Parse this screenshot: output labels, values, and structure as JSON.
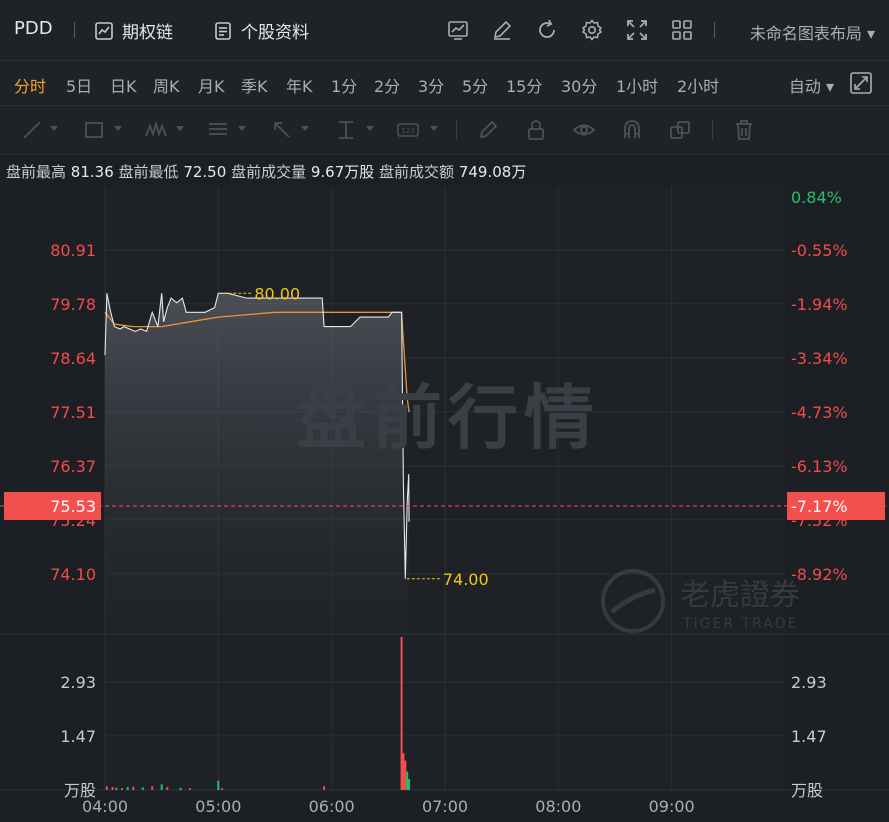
{
  "header": {
    "symbol": "PDD",
    "options_chain": "期权链",
    "profile": "个股资料",
    "layout_name": "未命名图表布局"
  },
  "timeframes": [
    "分时",
    "5日",
    "日K",
    "周K",
    "月K",
    "季K",
    "年K",
    "1分",
    "2分",
    "3分",
    "5分",
    "15分",
    "30分",
    "1小时",
    "2小时"
  ],
  "active_timeframe": "分时",
  "scale_mode": "自动",
  "premarket_stats": {
    "high_label": "盘前最高",
    "high": "81.36",
    "low_label": "盘前最低",
    "low": "72.50",
    "volume_label": "盘前成交量",
    "volume": "9.67万股",
    "turnover_label": "盘前成交额",
    "turnover": "749.08万"
  },
  "watermark": "盘前行情",
  "brand": {
    "cn": "老虎證券",
    "en": "TIGER TRADE"
  },
  "colors": {
    "up": "#20c36b",
    "down": "#f44d4d",
    "accent": "#f5a623",
    "current": "#f2504f"
  },
  "chart_data": {
    "type": "line",
    "x_ticks": [
      "04:00",
      "05:00",
      "06:00",
      "07:00",
      "08:00",
      "09:00"
    ],
    "price_ticks": [
      "80.91",
      "79.78",
      "78.64",
      "77.51",
      "76.37",
      "75.24",
      "74.10"
    ],
    "pct_ticks": [
      "0.84%",
      "-0.55%",
      "-1.94%",
      "-3.34%",
      "-4.73%",
      "-6.13%",
      "-7.52%",
      "-8.92%"
    ],
    "price_range": [
      73.0,
      82.0
    ],
    "current_price": "75.53",
    "current_pct": "-7.17%",
    "high_marker": "80.00",
    "low_marker": "74.00",
    "volume_ticks": [
      "2.93",
      "1.47"
    ],
    "volume_unit": "万股",
    "price_series": [
      {
        "t": "04:00",
        "v": 78.7
      },
      {
        "t": "04:01",
        "v": 80.0
      },
      {
        "t": "04:03",
        "v": 79.6
      },
      {
        "t": "04:05",
        "v": 79.3
      },
      {
        "t": "04:08",
        "v": 79.25
      },
      {
        "t": "04:10",
        "v": 79.3
      },
      {
        "t": "04:13",
        "v": 79.25
      },
      {
        "t": "04:16",
        "v": 79.2
      },
      {
        "t": "04:19",
        "v": 79.25
      },
      {
        "t": "04:22",
        "v": 79.2
      },
      {
        "t": "04:25",
        "v": 79.6
      },
      {
        "t": "04:28",
        "v": 79.3
      },
      {
        "t": "04:30",
        "v": 80.0
      },
      {
        "t": "04:31",
        "v": 79.4
      },
      {
        "t": "04:33",
        "v": 79.7
      },
      {
        "t": "04:35",
        "v": 79.9
      },
      {
        "t": "04:38",
        "v": 79.8
      },
      {
        "t": "04:41",
        "v": 79.9
      },
      {
        "t": "04:43",
        "v": 79.6
      },
      {
        "t": "04:48",
        "v": 79.6
      },
      {
        "t": "04:53",
        "v": 79.6
      },
      {
        "t": "04:58",
        "v": 79.7
      },
      {
        "t": "05:00",
        "v": 80.0
      },
      {
        "t": "05:05",
        "v": 80.0
      },
      {
        "t": "05:15",
        "v": 79.9
      },
      {
        "t": "05:30",
        "v": 79.9
      },
      {
        "t": "05:45",
        "v": 79.9
      },
      {
        "t": "05:55",
        "v": 79.9
      },
      {
        "t": "05:56",
        "v": 79.3
      },
      {
        "t": "06:10",
        "v": 79.3
      },
      {
        "t": "06:15",
        "v": 79.5
      },
      {
        "t": "06:30",
        "v": 79.5
      },
      {
        "t": "06:32",
        "v": 79.6
      },
      {
        "t": "06:37",
        "v": 79.6
      },
      {
        "t": "06:38",
        "v": 76.0
      },
      {
        "t": "06:39",
        "v": 74.0
      },
      {
        "t": "06:40",
        "v": 75.6
      },
      {
        "t": "06:40",
        "v": 76.2
      },
      {
        "t": "06:41",
        "v": 75.2
      }
    ],
    "avg_series": [
      {
        "t": "04:00",
        "v": 79.6
      },
      {
        "t": "04:05",
        "v": 79.35
      },
      {
        "t": "04:15",
        "v": 79.3
      },
      {
        "t": "04:30",
        "v": 79.3
      },
      {
        "t": "04:45",
        "v": 79.4
      },
      {
        "t": "05:00",
        "v": 79.5
      },
      {
        "t": "05:30",
        "v": 79.6
      },
      {
        "t": "06:00",
        "v": 79.6
      },
      {
        "t": "06:37",
        "v": 79.6
      },
      {
        "t": "06:38",
        "v": 79.0
      },
      {
        "t": "06:40",
        "v": 77.8
      },
      {
        "t": "06:41",
        "v": 77.5
      }
    ],
    "volume_bars": [
      {
        "t": "04:01",
        "v": 0.1,
        "dir": "down"
      },
      {
        "t": "04:04",
        "v": 0.08,
        "dir": "down"
      },
      {
        "t": "04:06",
        "v": 0.06,
        "dir": "up"
      },
      {
        "t": "04:09",
        "v": 0.05,
        "dir": "down"
      },
      {
        "t": "04:12",
        "v": 0.08,
        "dir": "up"
      },
      {
        "t": "04:15",
        "v": 0.09,
        "dir": "down"
      },
      {
        "t": "04:20",
        "v": 0.07,
        "dir": "up"
      },
      {
        "t": "04:25",
        "v": 0.1,
        "dir": "down"
      },
      {
        "t": "04:30",
        "v": 0.15,
        "dir": "up"
      },
      {
        "t": "04:33",
        "v": 0.08,
        "dir": "down"
      },
      {
        "t": "04:40",
        "v": 0.06,
        "dir": "up"
      },
      {
        "t": "04:45",
        "v": 0.05,
        "dir": "down"
      },
      {
        "t": "05:00",
        "v": 0.25,
        "dir": "up"
      },
      {
        "t": "05:02",
        "v": 0.05,
        "dir": "down"
      },
      {
        "t": "05:56",
        "v": 0.1,
        "dir": "down"
      },
      {
        "t": "06:37",
        "v": 4.15,
        "dir": "down"
      },
      {
        "t": "06:38",
        "v": 1.0,
        "dir": "down"
      },
      {
        "t": "06:39",
        "v": 0.8,
        "dir": "down"
      },
      {
        "t": "06:40",
        "v": 0.5,
        "dir": "up"
      },
      {
        "t": "06:41",
        "v": 0.3,
        "dir": "up"
      }
    ]
  }
}
